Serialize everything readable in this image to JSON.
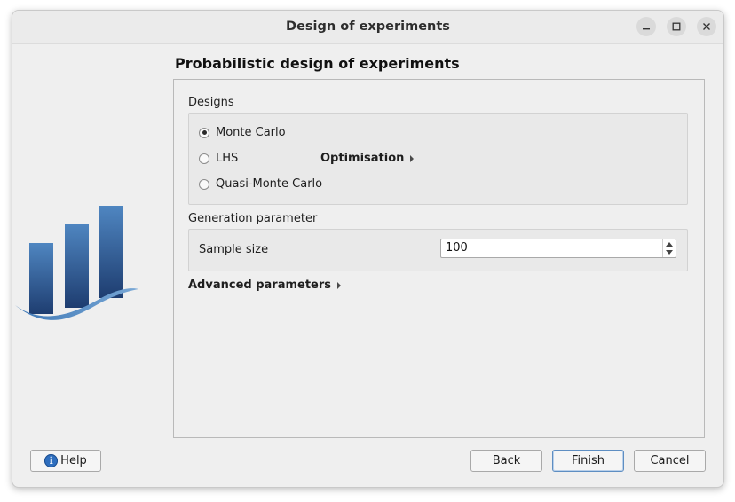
{
  "window": {
    "title": "Design of experiments"
  },
  "wizard": {
    "heading": "Probabilistic design of experiments"
  },
  "designs": {
    "label": "Designs",
    "options": [
      {
        "label": "Monte Carlo",
        "checked": true
      },
      {
        "label": "LHS",
        "checked": false
      },
      {
        "label": "Quasi-Monte Carlo",
        "checked": false
      }
    ],
    "optimisation_label": "Optimisation"
  },
  "generation": {
    "label": "Generation parameter",
    "sample_size_label": "Sample size",
    "sample_size_value": "100"
  },
  "advanced": {
    "label": "Advanced parameters"
  },
  "buttons": {
    "help": "Help",
    "back": "Back",
    "finish": "Finish",
    "cancel": "Cancel"
  },
  "colors": {
    "logo_dark": "#1f3f73",
    "logo_light": "#5a8fc8",
    "default_button_border": "#5e8ec2",
    "help_icon": "#2f6fbf"
  }
}
